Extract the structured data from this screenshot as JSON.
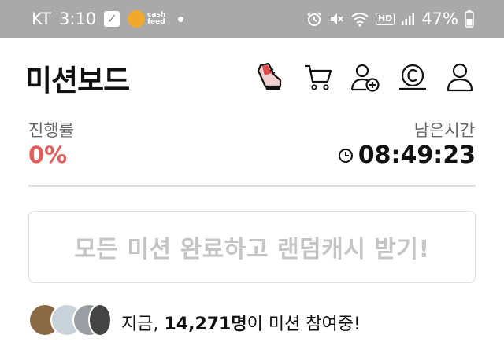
{
  "status_bar": {
    "carrier": "KT",
    "time": "3:10",
    "app_badge_line1": "cash",
    "app_badge_line2": "feed",
    "hd_label": "HD",
    "battery": "47%"
  },
  "header": {
    "title": "미션보드",
    "icons": [
      "shoe-icon",
      "cart-icon",
      "add-friend-icon",
      "coin-icon",
      "profile-icon"
    ]
  },
  "progress": {
    "label": "진행률",
    "value": "0%"
  },
  "remaining": {
    "label": "남은시간",
    "value": "08:49:23"
  },
  "reward_button": {
    "label": "모든 미션 완료하고 랜덤캐시 받기!"
  },
  "participants": {
    "prefix": "지금, ",
    "count": "14,271명",
    "suffix": "이 미션 참여중!",
    "avatar_colors": [
      "#8a6a45",
      "#c9d2d8",
      "#9a9da2",
      "#444444"
    ]
  },
  "colors": {
    "accent_red": "#e35d5b",
    "status_bar_bg": "#a9a9a9",
    "disabled_text": "#c4c4c4"
  }
}
